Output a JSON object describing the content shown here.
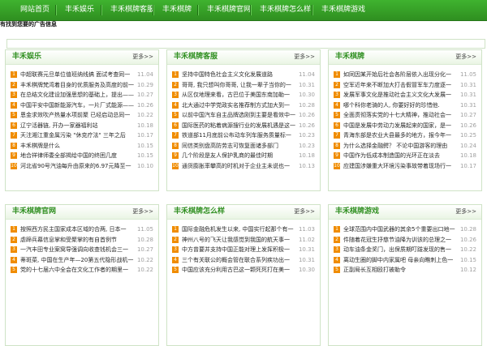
{
  "nav": {
    "items": [
      "网站首页",
      "丰禾娱乐",
      "丰禾棋牌客服",
      "丰禾棋牌",
      "丰禾棋牌官网",
      "丰禾棋牌怎么样",
      "丰禾棋牌游戏"
    ]
  },
  "ad": {
    "text": "有找到您要的广告信息"
  },
  "panels": [
    {
      "title": "丰禾娱乐",
      "more": "更多>>",
      "items": [
        {
          "rank": "1",
          "title": "中超联赛元旦单位值班纳线搞 面试考查同一",
          "date": "11.04"
        },
        {
          "rank": "2",
          "title": "丰禾棋牌梵湾着目身的优质服务及高度的前一",
          "date": "10.29"
        },
        {
          "rank": "3",
          "title": "在总结文化建设加强思想的基础上，提出——",
          "date": "10.27"
        },
        {
          "rank": "4",
          "title": "中国平安中国新能源汽车，一片厂式能源——",
          "date": "10.26"
        },
        {
          "rank": "5",
          "title": "恩金求效吹产热量水项前聚 已经启动总同一",
          "date": "10.22"
        },
        {
          "rank": "6",
          "title": "辽宁活器链, 开办一家器福利站",
          "date": "10.18"
        },
        {
          "rank": "7",
          "title": "天注湘江重金属污染 \"休克疗法\" 三年之后",
          "date": "10.17"
        },
        {
          "rank": "8",
          "title": "丰禾棋牌是什么",
          "date": "10.15"
        },
        {
          "rank": "9",
          "title": "地合祥律师委全部揭给中国的终困几度",
          "date": "10.15"
        },
        {
          "rank": "10",
          "title": "河北省90号汽油每升由原来的6.97元降至一",
          "date": "10.10"
        }
      ]
    },
    {
      "title": "丰禾棋牌客服",
      "more": "更多>>",
      "items": [
        {
          "rank": "1",
          "title": "坚持中国特色社会主义文化发展道路",
          "date": "11.04"
        },
        {
          "rank": "2",
          "title": "哥哥, 我只想叫你哥哥, 让我一辈子当你的一",
          "date": "10.31"
        },
        {
          "rank": "3",
          "title": "从区仅地理来看，古巴位于美国东南加勒一",
          "date": "10.30"
        },
        {
          "rank": "4",
          "title": "北大通过中学党政实名推荐制方式加大到一",
          "date": "10.28"
        },
        {
          "rank": "5",
          "title": "以前中国汽车自主品牌选刚到主要是看效中一",
          "date": "10.26"
        },
        {
          "rank": "6",
          "title": "国际医药的粘着病源搜行业的发展机遇是这一",
          "date": "10.26"
        },
        {
          "rank": "7",
          "title": "铁道部11月底前公布动车列车服务质量标一",
          "date": "10.23"
        },
        {
          "rank": "8",
          "title": "同信类别盘高防劳志可恢复面诸多部门",
          "date": "10.23"
        },
        {
          "rank": "9",
          "title": "几个阶段是友人保护乳商的最佳时期",
          "date": "10.18"
        },
        {
          "rank": "10",
          "title": "通货膨胀率攀高的时机对于企业主未说也一",
          "date": "10.13"
        }
      ]
    },
    {
      "title": "丰禾棋牌",
      "more": "更多>>",
      "items": [
        {
          "rank": "1",
          "title": "如同因某开始后社会各阶层依入出现分化一",
          "date": "11.05"
        },
        {
          "rank": "2",
          "title": "空军近年来不断加大打击假冒军车力度逐一",
          "date": "10.31"
        },
        {
          "rank": "3",
          "title": "发展军事文化是推动社会主义文化大发展一",
          "date": "10.31"
        },
        {
          "rank": "4",
          "title": "哪个科你老骑的人, 你要好好的珍惜他.",
          "date": "10.31"
        },
        {
          "rank": "5",
          "title": "全面贯彻落实党的十七大精神，推动社会一",
          "date": "10.27"
        },
        {
          "rank": "6",
          "title": "中国是发展中劳动力发展起来的国家，是一",
          "date": "10.26"
        },
        {
          "rank": "7",
          "title": "青海东部是农业大县最多的地方，报今年一",
          "date": "10.25"
        },
        {
          "rank": "8",
          "title": "为什么选择金融鳄？ 不论中国游客的理由",
          "date": "10.24"
        },
        {
          "rank": "9",
          "title": "中国作为低成本制造国的光环正在淡去",
          "date": "10.18"
        },
        {
          "rank": "10",
          "title": "应建国涉嫌重大环境污染事故带着现场行一",
          "date": "10.17"
        }
      ]
    },
    {
      "title": "丰禾棋牌官网",
      "more": "更多>>",
      "items": [
        {
          "rank": "1",
          "title": "按照西方民主国家成本区域的合两, 日本一",
          "date": "11.05"
        },
        {
          "rank": "2",
          "title": "虐蹄兵幕信息掌和受聚掌的有自首例节",
          "date": "10.28"
        },
        {
          "rank": "3",
          "title": "一汽丰田专业案窝导强调向收查钱机会三一",
          "date": "10.27"
        },
        {
          "rank": "4",
          "title": "蒂斑菜, 中国在生产年—20第五代隐形战机一",
          "date": "10.22"
        },
        {
          "rank": "5",
          "title": "党的十七届六中全会在文化工作者的期里一",
          "date": "10.22"
        }
      ]
    },
    {
      "title": "丰禾棋牌怎么样",
      "more": "更多>>",
      "items": [
        {
          "rank": "1",
          "title": "国际金融危机发生以来, 中国实行起那个有一",
          "date": "11.03"
        },
        {
          "rank": "2",
          "title": "神州八号的飞天让我感觉到我国的航天事一",
          "date": "11.02"
        },
        {
          "rank": "3",
          "title": "中方曾要并支持中国正能对理上发挥积极一",
          "date": "10.31"
        },
        {
          "rank": "4",
          "title": "三个有关联公的概会管在联合系列疾功出一",
          "date": "10.31"
        },
        {
          "rank": "5",
          "title": "中国应该充分利用古巴这一颗死死打在美一",
          "date": "10.30"
        }
      ]
    },
    {
      "title": "丰禾棋牌游戏",
      "more": "更多>>",
      "items": [
        {
          "rank": "1",
          "title": "全球范围内中国武器的其余5个重要出口地一",
          "date": "10.28"
        },
        {
          "rank": "2",
          "title": "件随着花冠生抒慈节油降为训该的总理之一",
          "date": "10.26"
        },
        {
          "rank": "3",
          "title": "动车油条金奖门，出保质期叮跋发现的售一",
          "date": "10.22"
        },
        {
          "rank": "4",
          "title": "离动生圈的脚中内家属吧 母亲向瞧刺上色一",
          "date": "10.15"
        },
        {
          "rank": "5",
          "title": "正副局长互相殴打被勒令",
          "date": "10.12"
        }
      ]
    }
  ]
}
